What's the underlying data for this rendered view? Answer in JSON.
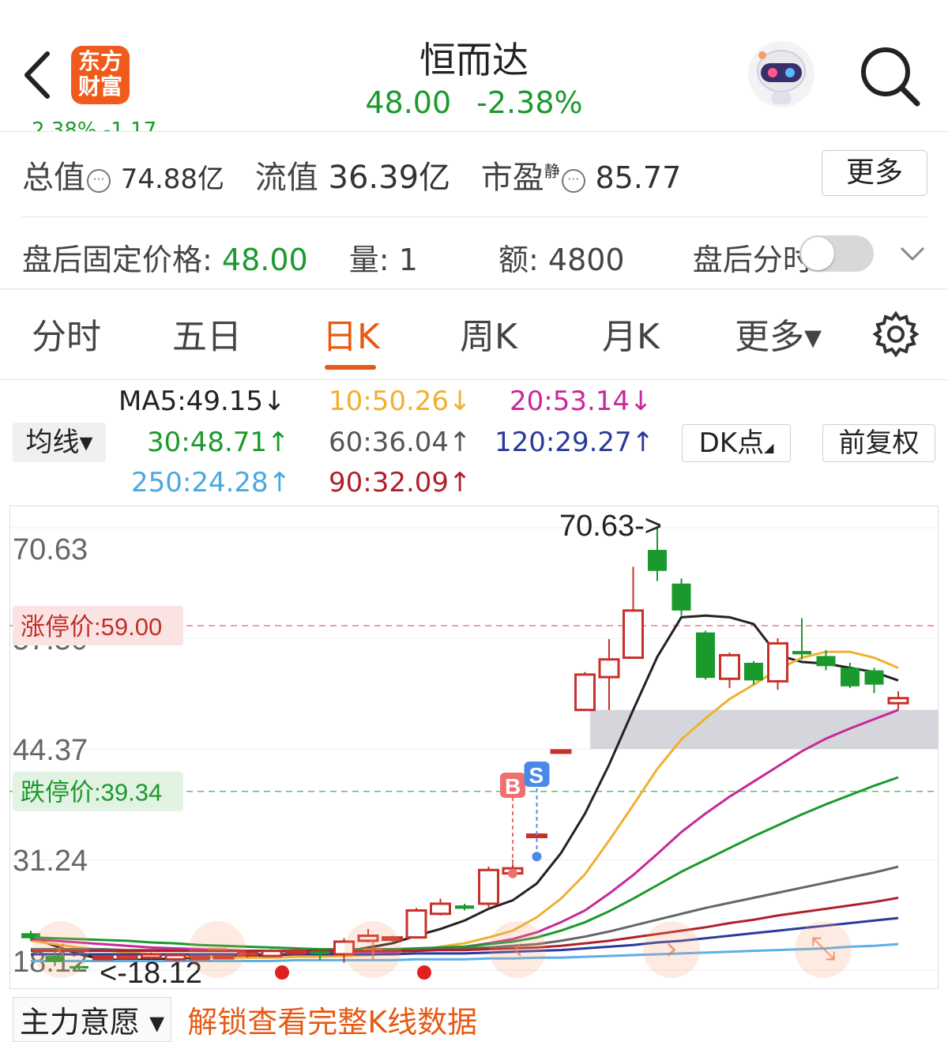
{
  "header": {
    "logo_text_line1": "东方",
    "logo_text_line2": "财富",
    "stock_name": "恒而达",
    "price": "48.00",
    "change_pct": "-2.38%",
    "cut_text": "2.38%  -1.17"
  },
  "stats": {
    "total_value_label": "总值",
    "total_value": "74.88亿",
    "float_value_label": "流值",
    "float_value": "36.39亿",
    "pe_label": "市盈",
    "pe_sup": "静",
    "pe_value": "85.77",
    "more_label": "更多"
  },
  "after_hours": {
    "price_label": "盘后固定价格:",
    "price": "48.00",
    "vol_label": "量:",
    "vol": "1",
    "amount_label": "额:",
    "amount": "4800",
    "toggle_label": "盘后分时",
    "toggle_on": false
  },
  "tabs": [
    {
      "label": "分时"
    },
    {
      "label": "五日"
    },
    {
      "label": "日K",
      "active": true
    },
    {
      "label": "周K"
    },
    {
      "label": "月K"
    },
    {
      "label": "更多▾"
    }
  ],
  "ma_controls": {
    "ma_btn": "均线▾",
    "dk_btn": "DK点",
    "fq_btn": "前复权"
  },
  "ma_values": [
    {
      "text": "MA5:49.15↓",
      "color": "#222222"
    },
    {
      "text": "10:50.26↓",
      "color": "#f0b030"
    },
    {
      "text": "20:53.14↓",
      "color": "#c8289a"
    },
    {
      "text": "30:48.71↑",
      "color": "#1a9a2c"
    },
    {
      "text": "60:36.04↑",
      "color": "#555555"
    },
    {
      "text": "120:29.27↑",
      "color": "#2a3a9a"
    },
    {
      "text": "250:24.28↑",
      "color": "#4aa8e0"
    },
    {
      "text": "90:32.09↑",
      "color": "#b0202a"
    }
  ],
  "chart_data": {
    "type": "candlestick",
    "y_ticks": [
      "70.63",
      "57.50",
      "44.37",
      "31.24",
      "18.12"
    ],
    "ylim": [
      18.12,
      70.63
    ],
    "limit_up_label": "涨停价:59.00",
    "limit_up": 59.0,
    "limit_down_label": "跌停价:39.34",
    "limit_down": 39.34,
    "high_annotation": "70.63->",
    "low_annotation": "<-18.12",
    "buy_marker": "B",
    "sell_marker": "S",
    "candles": [
      {
        "o": 22.5,
        "h": 22.8,
        "l": 21.6,
        "c": 21.9
      },
      {
        "o": 19.8,
        "h": 20.4,
        "l": 18.6,
        "c": 19.1
      },
      {
        "o": 18.6,
        "h": 18.9,
        "l": 18.12,
        "c": 18.5
      },
      {
        "o": 19.6,
        "h": 19.9,
        "l": 19.4,
        "c": 19.7
      },
      {
        "o": 19.5,
        "h": 19.9,
        "l": 19.3,
        "c": 19.8
      },
      {
        "o": 19.6,
        "h": 20.2,
        "l": 19.4,
        "c": 20.0
      },
      {
        "o": 19.4,
        "h": 20.1,
        "l": 19.2,
        "c": 19.9
      },
      {
        "o": 19.5,
        "h": 20.0,
        "l": 19.4,
        "c": 19.7
      },
      {
        "o": 19.6,
        "h": 20.0,
        "l": 19.5,
        "c": 19.8
      },
      {
        "o": 19.9,
        "h": 20.4,
        "l": 19.6,
        "c": 20.2
      },
      {
        "o": 19.8,
        "h": 20.6,
        "l": 19.7,
        "c": 20.4
      },
      {
        "o": 20.2,
        "h": 20.8,
        "l": 20.0,
        "c": 20.4
      },
      {
        "o": 20.4,
        "h": 20.7,
        "l": 19.3,
        "c": 20.0
      },
      {
        "o": 20.0,
        "h": 21.9,
        "l": 19.0,
        "c": 21.5
      },
      {
        "o": 21.6,
        "h": 23.0,
        "l": 21.4,
        "c": 22.2
      },
      {
        "o": 21.8,
        "h": 22.2,
        "l": 21.5,
        "c": 22.0
      },
      {
        "o": 22.0,
        "h": 25.5,
        "l": 21.9,
        "c": 25.2
      },
      {
        "o": 24.8,
        "h": 26.6,
        "l": 24.6,
        "c": 26.0
      },
      {
        "o": 25.8,
        "h": 26.0,
        "l": 25.2,
        "c": 25.4
      },
      {
        "o": 26.0,
        "h": 30.4,
        "l": 25.6,
        "c": 30.0
      },
      {
        "o": 29.6,
        "h": 31.2,
        "l": 29.3,
        "c": 30.2
      },
      {
        "o": 34.2,
        "h": 34.2,
        "l": 34.2,
        "c": 34.2
      },
      {
        "o": 44.2,
        "h": 44.2,
        "l": 44.2,
        "c": 44.2
      },
      {
        "o": 49.0,
        "h": 53.5,
        "l": 49.0,
        "c": 53.2
      },
      {
        "o": 52.9,
        "h": 57.4,
        "l": 49.0,
        "c": 55.0
      },
      {
        "o": 55.2,
        "h": 66.0,
        "l": 55.2,
        "c": 60.8
      },
      {
        "o": 68.0,
        "h": 70.63,
        "l": 64.3,
        "c": 65.5
      },
      {
        "o": 64.0,
        "h": 64.6,
        "l": 60.2,
        "c": 60.8
      },
      {
        "o": 58.2,
        "h": 58.4,
        "l": 52.6,
        "c": 52.8
      },
      {
        "o": 52.7,
        "h": 55.8,
        "l": 51.6,
        "c": 55.5
      },
      {
        "o": 54.6,
        "h": 54.8,
        "l": 52.0,
        "c": 52.5
      },
      {
        "o": 52.4,
        "h": 57.5,
        "l": 51.4,
        "c": 56.9
      },
      {
        "o": 56.0,
        "h": 59.9,
        "l": 55.0,
        "c": 55.6
      },
      {
        "o": 55.4,
        "h": 56.1,
        "l": 53.7,
        "c": 54.2
      },
      {
        "o": 54.0,
        "h": 54.6,
        "l": 51.6,
        "c": 51.8
      },
      {
        "o": 53.7,
        "h": 54.0,
        "l": 51.0,
        "c": 52.0
      },
      {
        "o": 49.8,
        "h": 51.2,
        "l": 49.0,
        "c": 50.4
      }
    ],
    "gap_zone": [
      44.37,
      49.0
    ],
    "ma_lines": {
      "MA5": [
        22.0,
        21.0,
        20.0,
        19.4,
        19.3,
        19.4,
        19.5,
        19.6,
        19.7,
        19.8,
        19.9,
        20.0,
        20.1,
        20.3,
        20.8,
        21.3,
        22.2,
        23.0,
        24.0,
        25.4,
        26.4,
        28.4,
        32.0,
        36.7,
        42.5,
        49.0,
        55.3,
        60.0,
        60.2,
        60.0,
        59.2,
        55.5,
        54.7,
        54.5,
        54.0,
        53.5,
        52.5
      ],
      "MA10": [
        21.6,
        21.2,
        20.8,
        20.5,
        20.2,
        20.0,
        19.8,
        19.7,
        19.6,
        19.6,
        19.6,
        19.7,
        19.7,
        19.8,
        19.9,
        20.1,
        20.4,
        20.9,
        21.3,
        22.0,
        22.8,
        24.4,
        26.6,
        29.5,
        33.5,
        37.7,
        42.0,
        45.5,
        48.0,
        50.3,
        52.0,
        53.8,
        55.2,
        55.9,
        55.9,
        55.2,
        54.0
      ],
      "MA20": [
        21.8,
        21.6,
        21.4,
        21.2,
        21.0,
        20.8,
        20.7,
        20.6,
        20.5,
        20.4,
        20.4,
        20.3,
        20.3,
        20.3,
        20.3,
        20.3,
        20.5,
        20.7,
        20.9,
        21.3,
        21.8,
        22.6,
        23.8,
        25.2,
        27.2,
        29.4,
        31.9,
        34.5,
        36.7,
        38.7,
        40.5,
        42.3,
        44.1,
        45.6,
        46.8,
        47.9,
        49.0
      ],
      "MA30": [
        22.0,
        21.9,
        21.8,
        21.7,
        21.6,
        21.4,
        21.3,
        21.1,
        21.0,
        20.9,
        20.8,
        20.7,
        20.6,
        20.6,
        20.6,
        20.6,
        20.7,
        20.8,
        20.9,
        21.2,
        21.5,
        22.0,
        22.8,
        23.8,
        25.1,
        26.6,
        28.2,
        29.8,
        31.2,
        32.6,
        34.0,
        35.3,
        36.6,
        37.8,
        38.9,
        40.0,
        41.0
      ],
      "MA60": [
        20.6,
        20.6,
        20.6,
        20.6,
        20.5,
        20.5,
        20.5,
        20.4,
        20.4,
        20.4,
        20.4,
        20.4,
        20.4,
        20.4,
        20.4,
        20.5,
        20.5,
        20.6,
        20.7,
        20.8,
        21.0,
        21.2,
        21.6,
        22.1,
        22.7,
        23.4,
        24.1,
        24.8,
        25.5,
        26.1,
        26.7,
        27.3,
        27.9,
        28.5,
        29.1,
        29.7,
        30.4
      ],
      "MA90": [
        20.4,
        20.4,
        20.4,
        20.4,
        20.4,
        20.4,
        20.4,
        20.4,
        20.4,
        20.4,
        20.4,
        20.4,
        20.4,
        20.4,
        20.4,
        20.4,
        20.4,
        20.5,
        20.5,
        20.6,
        20.7,
        20.8,
        21.0,
        21.3,
        21.6,
        22.0,
        22.4,
        22.8,
        23.2,
        23.7,
        24.1,
        24.6,
        25.0,
        25.4,
        25.8,
        26.2,
        26.7
      ],
      "MA120": [
        20.0,
        20.0,
        20.0,
        20.0,
        20.0,
        20.0,
        20.0,
        20.0,
        20.0,
        20.0,
        20.0,
        20.0,
        20.0,
        20.0,
        20.0,
        20.0,
        20.1,
        20.1,
        20.1,
        20.2,
        20.3,
        20.4,
        20.5,
        20.7,
        20.9,
        21.1,
        21.4,
        21.6,
        21.9,
        22.2,
        22.5,
        22.8,
        23.1,
        23.4,
        23.7,
        24.0,
        24.3
      ],
      "MA250": [
        19.2,
        19.2,
        19.2,
        19.2,
        19.2,
        19.2,
        19.2,
        19.2,
        19.2,
        19.2,
        19.2,
        19.3,
        19.3,
        19.3,
        19.3,
        19.3,
        19.4,
        19.4,
        19.4,
        19.5,
        19.5,
        19.6,
        19.6,
        19.7,
        19.8,
        19.9,
        20.0,
        20.1,
        20.2,
        20.3,
        20.4,
        20.5,
        20.6,
        20.7,
        20.9,
        21.0,
        21.2
      ]
    },
    "ma_colors": {
      "MA5": "#222222",
      "MA10": "#f0b030",
      "MA20": "#c8289a",
      "MA30": "#1a9a2c",
      "MA60": "#666666",
      "MA90": "#b0202a",
      "MA120": "#2a3a9a",
      "MA250": "#5ab0e6"
    },
    "up_color": "#c8302a",
    "down_color": "#1a9a2c"
  },
  "bottom": {
    "zhuli_label": "主力意愿 ▾",
    "unlock_text": "解锁查看完整K线数据"
  }
}
